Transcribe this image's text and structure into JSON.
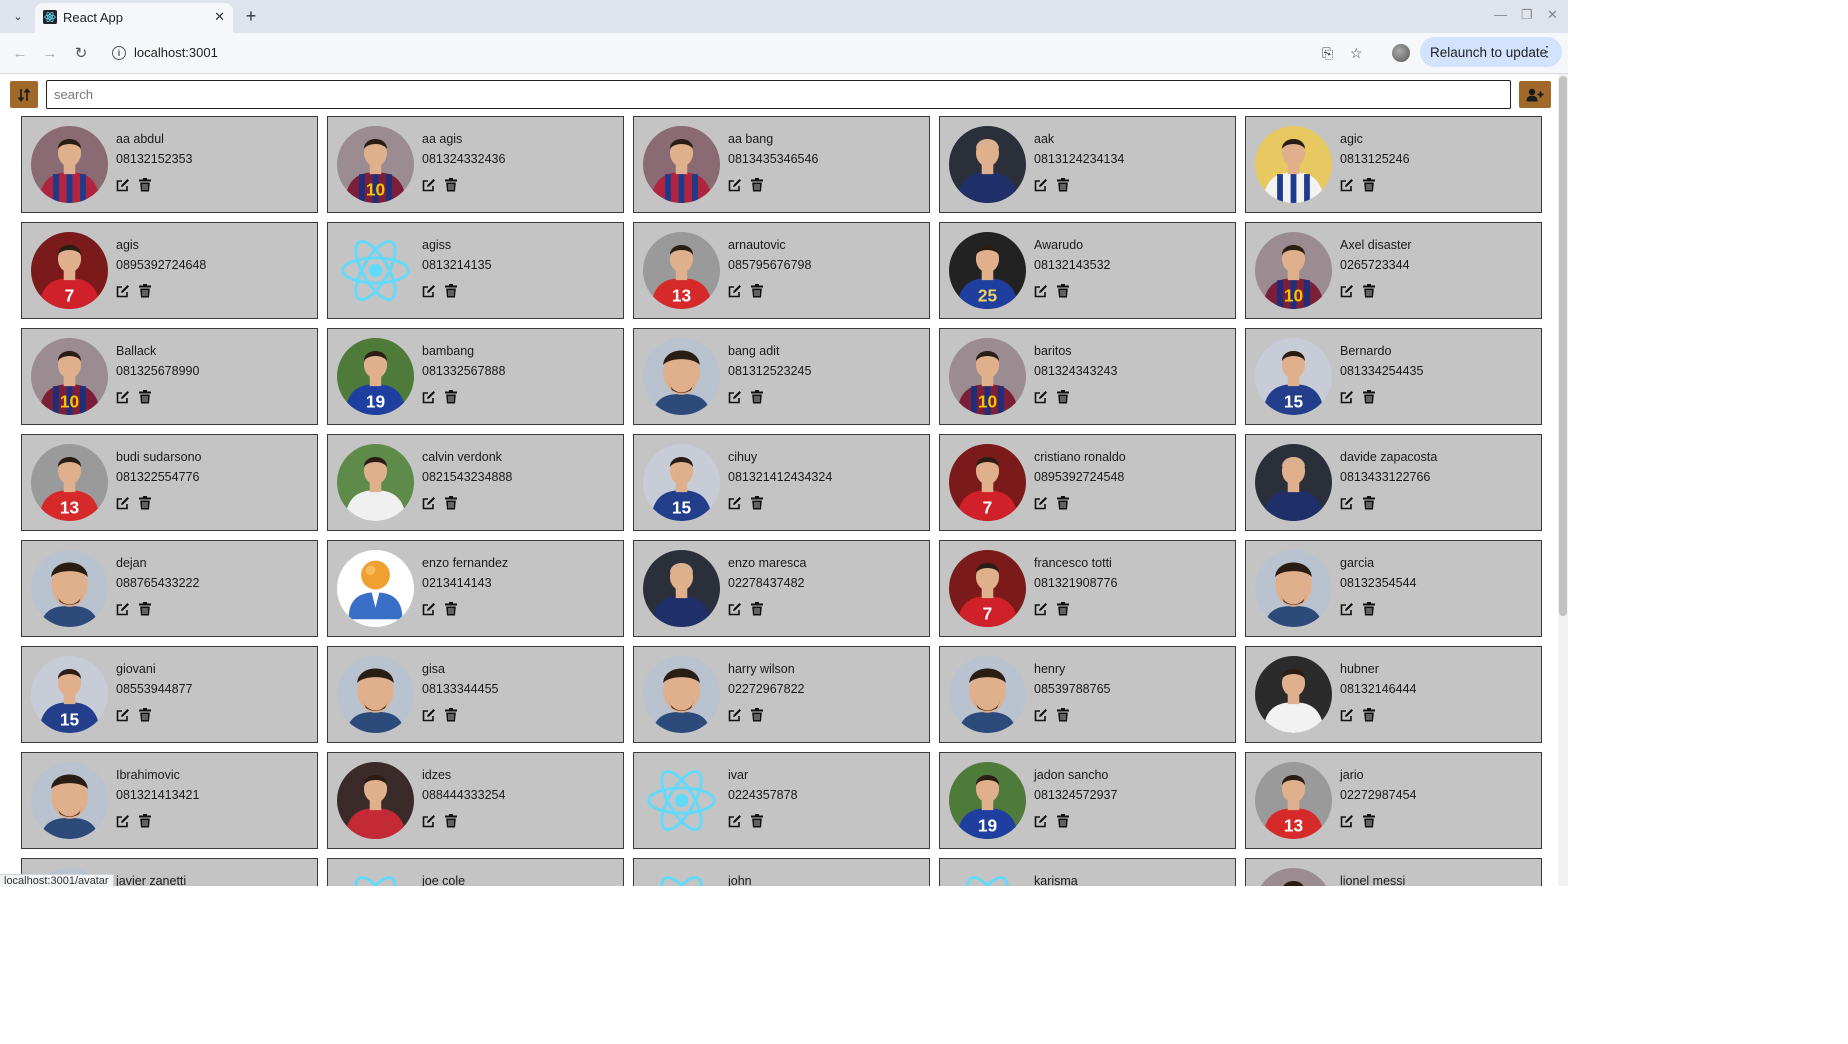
{
  "browser": {
    "tab_title": "React App",
    "url": "localhost:3001",
    "relaunch_label": "Relaunch to update"
  },
  "toolbar": {
    "search_placeholder": "search",
    "sort_icon": "sort-icon",
    "add_icon": "add-user-icon"
  },
  "status_bar": {
    "text": "localhost:3001/avatar"
  },
  "colors": {
    "button_brown": "#a0692a",
    "card_bg": "#c4c4c4",
    "react_blue": "#61dafb"
  },
  "contacts": [
    {
      "name": "aa abdul",
      "phone": "08132152353",
      "avatar": "barca-red"
    },
    {
      "name": "aa agis",
      "phone": "081324332436",
      "avatar": "barca-10"
    },
    {
      "name": "aa bang",
      "phone": "0813435346546",
      "avatar": "barca-red"
    },
    {
      "name": "aak",
      "phone": "0813124234134",
      "avatar": "coach"
    },
    {
      "name": "agic",
      "phone": "0813125246",
      "avatar": "white-kit"
    },
    {
      "name": "agis",
      "phone": "0895392724648",
      "avatar": "red-7"
    },
    {
      "name": "agiss",
      "phone": "0813214135",
      "avatar": "react"
    },
    {
      "name": "arnautovic",
      "phone": "085795676798",
      "avatar": "red-13"
    },
    {
      "name": "Awarudo",
      "phone": "08132143532",
      "avatar": "blue-25"
    },
    {
      "name": "Axel disaster",
      "phone": "0265723344",
      "avatar": "barca-10"
    },
    {
      "name": "Ballack",
      "phone": "081325678990",
      "avatar": "barca-10"
    },
    {
      "name": "bambang",
      "phone": "081332567888",
      "avatar": "blue-19"
    },
    {
      "name": "bang adit",
      "phone": "081312523245",
      "avatar": "face"
    },
    {
      "name": "baritos",
      "phone": "081324343243",
      "avatar": "barca-10"
    },
    {
      "name": "Bernardo",
      "phone": "081334254435",
      "avatar": "blue-15"
    },
    {
      "name": "budi sudarsono",
      "phone": "081322554776",
      "avatar": "red-13"
    },
    {
      "name": "calvin verdonk",
      "phone": "0821543234888",
      "avatar": "pitch-white"
    },
    {
      "name": "cihuy",
      "phone": "081321412434324",
      "avatar": "blue-15"
    },
    {
      "name": "cristiano ronaldo",
      "phone": "0895392724548",
      "avatar": "red-7"
    },
    {
      "name": "davide zapacosta",
      "phone": "0813433122766",
      "avatar": "coach"
    },
    {
      "name": "dejan",
      "phone": "088765433222",
      "avatar": "face"
    },
    {
      "name": "enzo fernandez",
      "phone": "0213414143",
      "avatar": "default-user"
    },
    {
      "name": "enzo maresca",
      "phone": "02278437482",
      "avatar": "coach"
    },
    {
      "name": "francesco totti",
      "phone": "081321908776",
      "avatar": "red-7"
    },
    {
      "name": "garcia",
      "phone": "08132354544",
      "avatar": "face"
    },
    {
      "name": "giovani",
      "phone": "08553944877",
      "avatar": "blue-15"
    },
    {
      "name": "gisa",
      "phone": "08133344455",
      "avatar": "face"
    },
    {
      "name": "harry wilson",
      "phone": "02272967822",
      "avatar": "face"
    },
    {
      "name": "henry",
      "phone": "08539788765",
      "avatar": "face"
    },
    {
      "name": "hubner",
      "phone": "08132146444",
      "avatar": "white-shirt"
    },
    {
      "name": "Ibrahimovic",
      "phone": "081321413421",
      "avatar": "face"
    },
    {
      "name": "idzes",
      "phone": "088444333254",
      "avatar": "red-dark"
    },
    {
      "name": "ivar",
      "phone": "0224357878",
      "avatar": "react"
    },
    {
      "name": "jadon sancho",
      "phone": "081324572937",
      "avatar": "blue-19"
    },
    {
      "name": "jario",
      "phone": "02272987454",
      "avatar": "red-13"
    },
    {
      "name": "javier zanetti",
      "phone": "",
      "avatar": "face"
    },
    {
      "name": "joe cole",
      "phone": "",
      "avatar": "react"
    },
    {
      "name": "john",
      "phone": "",
      "avatar": "react"
    },
    {
      "name": "karisma",
      "phone": "",
      "avatar": "react"
    },
    {
      "name": "lionel messi",
      "phone": "",
      "avatar": "barca-10"
    }
  ]
}
